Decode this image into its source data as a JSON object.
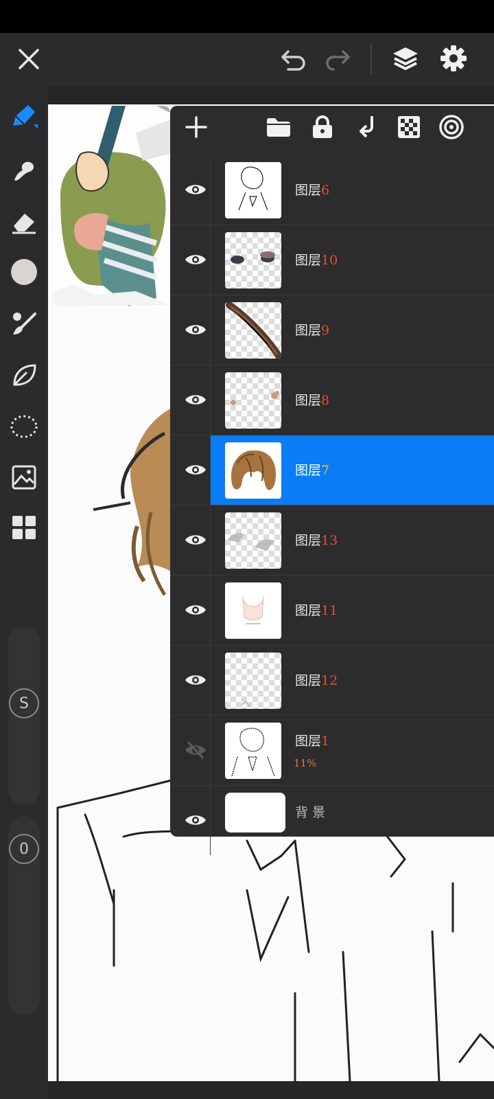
{
  "app": {
    "accent": "#0a7cf5",
    "number_color": "#e0522e"
  },
  "topbar": {
    "icons": [
      "close-icon",
      "undo-icon",
      "redo-icon",
      "layers-icon",
      "gear-icon"
    ]
  },
  "toolbar": {
    "tools": [
      "pen-tool-icon",
      "smudge-icon",
      "eraser-icon",
      "color-swatch",
      "brush-icon",
      "leaf-icon",
      "lasso-select-icon",
      "image-import-icon",
      "grid-icon"
    ],
    "size_label": "S",
    "opacity_label": "0"
  },
  "layers_panel": {
    "tools": [
      "add-layer-icon",
      "folder-icon",
      "lock-icon",
      "merge-down-icon",
      "transparency-icon",
      "settings-ring-icon"
    ],
    "layers": [
      {
        "prefix": "图层",
        "number": "6",
        "visible": true,
        "selected": false
      },
      {
        "prefix": "图层",
        "number": "10",
        "visible": true,
        "selected": false
      },
      {
        "prefix": "图层",
        "number": "9",
        "visible": true,
        "selected": false
      },
      {
        "prefix": "图层",
        "number": "8",
        "visible": true,
        "selected": false
      },
      {
        "prefix": "图层",
        "number": "7",
        "visible": true,
        "selected": true
      },
      {
        "prefix": "图层",
        "number": "13",
        "visible": true,
        "selected": false
      },
      {
        "prefix": "图层",
        "number": "11",
        "visible": true,
        "selected": false
      },
      {
        "prefix": "图层",
        "number": "12",
        "visible": true,
        "selected": false
      },
      {
        "prefix": "图层",
        "number": "1",
        "visible": false,
        "selected": false,
        "opacity": "11%"
      },
      {
        "prefix": "背 景",
        "number": "",
        "visible": true,
        "selected": false
      }
    ]
  }
}
